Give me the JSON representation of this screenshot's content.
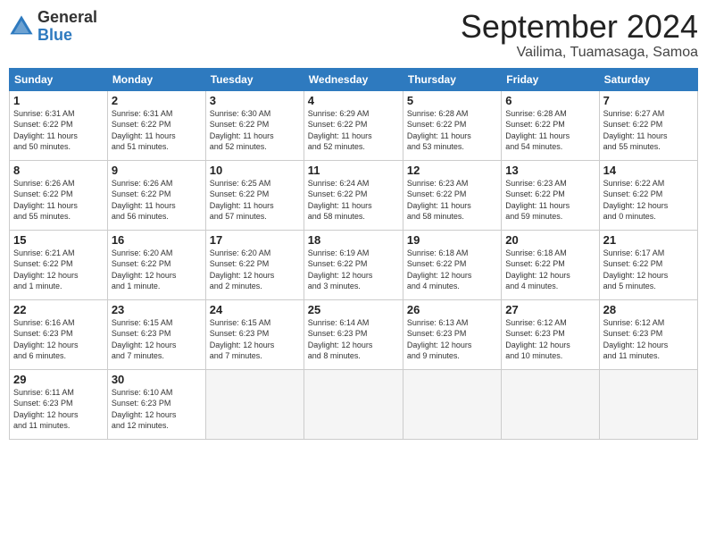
{
  "logo": {
    "general": "General",
    "blue": "Blue"
  },
  "title": "September 2024",
  "location": "Vailima, Tuamasaga, Samoa",
  "headers": [
    "Sunday",
    "Monday",
    "Tuesday",
    "Wednesday",
    "Thursday",
    "Friday",
    "Saturday"
  ],
  "weeks": [
    [
      {
        "day": "1",
        "info": "Sunrise: 6:31 AM\nSunset: 6:22 PM\nDaylight: 11 hours\nand 50 minutes."
      },
      {
        "day": "2",
        "info": "Sunrise: 6:31 AM\nSunset: 6:22 PM\nDaylight: 11 hours\nand 51 minutes."
      },
      {
        "day": "3",
        "info": "Sunrise: 6:30 AM\nSunset: 6:22 PM\nDaylight: 11 hours\nand 52 minutes."
      },
      {
        "day": "4",
        "info": "Sunrise: 6:29 AM\nSunset: 6:22 PM\nDaylight: 11 hours\nand 52 minutes."
      },
      {
        "day": "5",
        "info": "Sunrise: 6:28 AM\nSunset: 6:22 PM\nDaylight: 11 hours\nand 53 minutes."
      },
      {
        "day": "6",
        "info": "Sunrise: 6:28 AM\nSunset: 6:22 PM\nDaylight: 11 hours\nand 54 minutes."
      },
      {
        "day": "7",
        "info": "Sunrise: 6:27 AM\nSunset: 6:22 PM\nDaylight: 11 hours\nand 55 minutes."
      }
    ],
    [
      {
        "day": "8",
        "info": "Sunrise: 6:26 AM\nSunset: 6:22 PM\nDaylight: 11 hours\nand 55 minutes."
      },
      {
        "day": "9",
        "info": "Sunrise: 6:26 AM\nSunset: 6:22 PM\nDaylight: 11 hours\nand 56 minutes."
      },
      {
        "day": "10",
        "info": "Sunrise: 6:25 AM\nSunset: 6:22 PM\nDaylight: 11 hours\nand 57 minutes."
      },
      {
        "day": "11",
        "info": "Sunrise: 6:24 AM\nSunset: 6:22 PM\nDaylight: 11 hours\nand 58 minutes."
      },
      {
        "day": "12",
        "info": "Sunrise: 6:23 AM\nSunset: 6:22 PM\nDaylight: 11 hours\nand 58 minutes."
      },
      {
        "day": "13",
        "info": "Sunrise: 6:23 AM\nSunset: 6:22 PM\nDaylight: 11 hours\nand 59 minutes."
      },
      {
        "day": "14",
        "info": "Sunrise: 6:22 AM\nSunset: 6:22 PM\nDaylight: 12 hours\nand 0 minutes."
      }
    ],
    [
      {
        "day": "15",
        "info": "Sunrise: 6:21 AM\nSunset: 6:22 PM\nDaylight: 12 hours\nand 1 minute."
      },
      {
        "day": "16",
        "info": "Sunrise: 6:20 AM\nSunset: 6:22 PM\nDaylight: 12 hours\nand 1 minute."
      },
      {
        "day": "17",
        "info": "Sunrise: 6:20 AM\nSunset: 6:22 PM\nDaylight: 12 hours\nand 2 minutes."
      },
      {
        "day": "18",
        "info": "Sunrise: 6:19 AM\nSunset: 6:22 PM\nDaylight: 12 hours\nand 3 minutes."
      },
      {
        "day": "19",
        "info": "Sunrise: 6:18 AM\nSunset: 6:22 PM\nDaylight: 12 hours\nand 4 minutes."
      },
      {
        "day": "20",
        "info": "Sunrise: 6:18 AM\nSunset: 6:22 PM\nDaylight: 12 hours\nand 4 minutes."
      },
      {
        "day": "21",
        "info": "Sunrise: 6:17 AM\nSunset: 6:22 PM\nDaylight: 12 hours\nand 5 minutes."
      }
    ],
    [
      {
        "day": "22",
        "info": "Sunrise: 6:16 AM\nSunset: 6:23 PM\nDaylight: 12 hours\nand 6 minutes."
      },
      {
        "day": "23",
        "info": "Sunrise: 6:15 AM\nSunset: 6:23 PM\nDaylight: 12 hours\nand 7 minutes."
      },
      {
        "day": "24",
        "info": "Sunrise: 6:15 AM\nSunset: 6:23 PM\nDaylight: 12 hours\nand 7 minutes."
      },
      {
        "day": "25",
        "info": "Sunrise: 6:14 AM\nSunset: 6:23 PM\nDaylight: 12 hours\nand 8 minutes."
      },
      {
        "day": "26",
        "info": "Sunrise: 6:13 AM\nSunset: 6:23 PM\nDaylight: 12 hours\nand 9 minutes."
      },
      {
        "day": "27",
        "info": "Sunrise: 6:12 AM\nSunset: 6:23 PM\nDaylight: 12 hours\nand 10 minutes."
      },
      {
        "day": "28",
        "info": "Sunrise: 6:12 AM\nSunset: 6:23 PM\nDaylight: 12 hours\nand 11 minutes."
      }
    ],
    [
      {
        "day": "29",
        "info": "Sunrise: 6:11 AM\nSunset: 6:23 PM\nDaylight: 12 hours\nand 11 minutes."
      },
      {
        "day": "30",
        "info": "Sunrise: 6:10 AM\nSunset: 6:23 PM\nDaylight: 12 hours\nand 12 minutes."
      },
      null,
      null,
      null,
      null,
      null
    ]
  ]
}
